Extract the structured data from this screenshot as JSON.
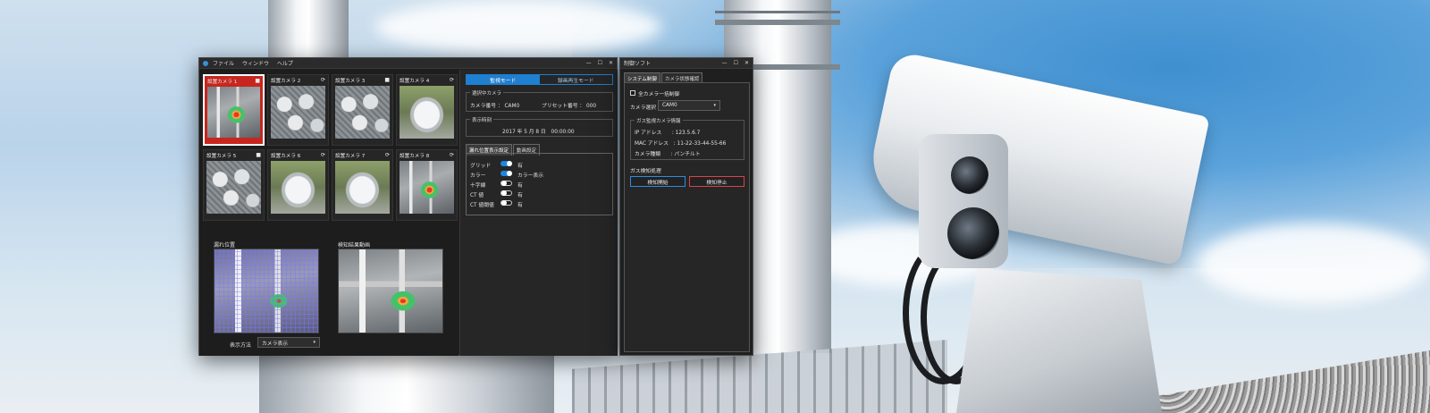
{
  "main_window": {
    "menu": [
      "ファイル",
      "ウィンドウ",
      "ヘルプ"
    ],
    "window_controls": [
      "—",
      "☐",
      "✕"
    ],
    "cameras": [
      {
        "label": "設置カメラ 1",
        "icon": "video-icon",
        "glyph": "■",
        "selected": true
      },
      {
        "label": "設置カメラ 2",
        "icon": "rotate-icon",
        "glyph": "⟳",
        "selected": false
      },
      {
        "label": "設置カメラ 3",
        "icon": "video-icon",
        "glyph": "■",
        "selected": false
      },
      {
        "label": "設置カメラ 4",
        "icon": "rotate-icon",
        "glyph": "⟳",
        "selected": false
      },
      {
        "label": "設置カメラ 5",
        "icon": "video-icon",
        "glyph": "■",
        "selected": false
      },
      {
        "label": "設置カメラ 6",
        "icon": "rotate-icon",
        "glyph": "⟳",
        "selected": false
      },
      {
        "label": "設置カメラ 7",
        "icon": "rotate-icon",
        "glyph": "⟳",
        "selected": false
      },
      {
        "label": "設置カメラ 8",
        "icon": "rotate-icon",
        "glyph": "⟳",
        "selected": false
      }
    ],
    "leak_position_label": "漏れ位置",
    "detection_video_label": "検知結果動画",
    "display_method_label": "表示方法",
    "display_method_value": "カメラ表示",
    "mode_tabs": {
      "monitor": "監視モード",
      "playback": "録画再生モード"
    },
    "selected_camera_title": "選択中カメラ",
    "camera_number": "カメラ番号 ： CAM0",
    "preset_number": "プリセット番号 ： 000",
    "display_time_title": "表示時刻",
    "display_time": "2017 年 5 月 8 日　00:00:00",
    "sub_tabs": [
      "漏れ位置表示設定",
      "動画設定"
    ],
    "settings": [
      {
        "label": "グリッド",
        "on": true,
        "value": "有"
      },
      {
        "label": "カラー",
        "on": true,
        "value": "カラー表示"
      },
      {
        "label": "十字線",
        "on": false,
        "value": "有"
      },
      {
        "label": "CT 値",
        "on": false,
        "value": "有"
      },
      {
        "label": "CT 値閾値",
        "on": false,
        "value": "有"
      }
    ]
  },
  "control_window": {
    "title": "制御ソフト",
    "window_controls": [
      "—",
      "☐",
      "✕"
    ],
    "tabs": [
      "システム制御",
      "カメラ状態確認"
    ],
    "all_camera_label": "全カメラ一括制御",
    "camera_select_label": "カメラ選択",
    "camera_select_value": "CAM0",
    "info_title": "ガス監視カメラ情報",
    "ip": "IP アドレス　　: 123.5.6.7",
    "mac": "MAC アドレス　: 11-22-33-44-55-66",
    "type": "カメラ種類　　: パンチルト",
    "gas_section": "ガス検知処理",
    "start_button": "検知開始",
    "stop_button": "検知停止"
  }
}
